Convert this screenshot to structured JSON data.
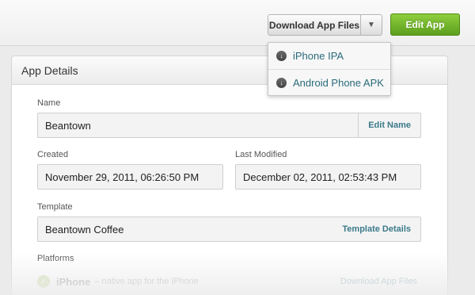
{
  "toolbar": {
    "download_label": "Download App Files",
    "caret_icon": "caret-down-icon",
    "edit_label": "Edit App"
  },
  "download_menu": {
    "items": [
      {
        "label": "iPhone IPA",
        "icon": "download-icon"
      },
      {
        "label": "Android Phone APK",
        "icon": "download-icon"
      }
    ]
  },
  "details": {
    "title": "App Details",
    "name_label": "Name",
    "name_value": "Beantown",
    "edit_name_label": "Edit Name",
    "created_label": "Created",
    "created_value": "November 29, 2011, 06:26:50 PM",
    "modified_label": "Last Modified",
    "modified_value": "December 02, 2011, 02:53:43 PM",
    "template_label": "Template",
    "template_value": "Beantown Coffee",
    "template_details_label": "Template Details",
    "platforms_label": "Platforms",
    "platforms": [
      {
        "name": "iPhone",
        "desc": "– native app for the iPhone",
        "link": "Download App Files",
        "icon": "check-icon"
      }
    ]
  },
  "colors": {
    "accent_green": "#5c9e1e",
    "link_teal": "#3b7a8a"
  }
}
